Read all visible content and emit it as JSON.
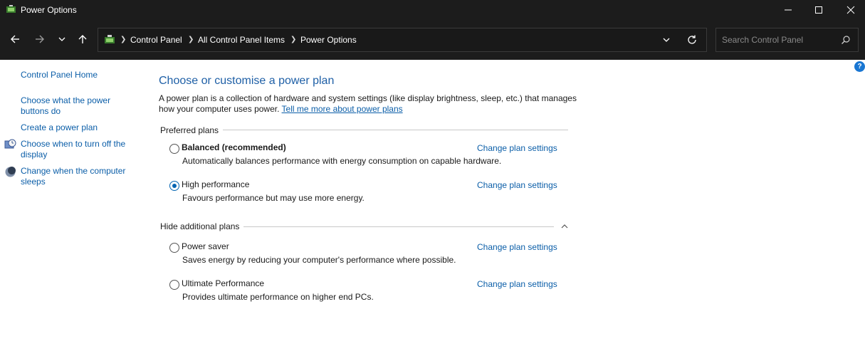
{
  "window": {
    "title": "Power Options",
    "icon": "power-options-icon",
    "controls": [
      "minimize-icon",
      "maximize-icon",
      "close-icon"
    ]
  },
  "nav": {
    "buttons": [
      "back-arrow-icon",
      "forward-arrow-icon",
      "recent-dropdown-icon",
      "up-arrow-icon"
    ],
    "breadcrumb": [
      "Control Panel",
      "All Control Panel Items",
      "Power Options"
    ],
    "search_placeholder": "Search Control Panel"
  },
  "sidebar": {
    "home": "Control Panel Home",
    "links": [
      "Choose what the power buttons do",
      "Create a power plan",
      "Choose when to turn off the display",
      "Change when the computer sleeps"
    ]
  },
  "main": {
    "heading": "Choose or customise a power plan",
    "description": "A power plan is a collection of hardware and system settings (like display brightness, sleep, etc.) that manages how your computer uses power.",
    "learn_more": "Tell me more about power plans",
    "preferred_label": "Preferred plans",
    "additional_label": "Hide additional plans",
    "change_link": "Change plan settings",
    "plans": [
      {
        "name": "Balanced (recommended)",
        "desc": "Automatically balances performance with energy consumption on capable hardware.",
        "selected": false
      },
      {
        "name": "High performance",
        "desc": "Favours performance but may use more energy.",
        "selected": true
      },
      {
        "name": "Power saver",
        "desc": "Saves energy by reducing your computer's performance where possible.",
        "selected": false
      },
      {
        "name": "Ultimate Performance",
        "desc": "Provides ultimate performance on higher end PCs.",
        "selected": false
      }
    ]
  },
  "colors": {
    "titlebar": "#1c1c1c",
    "link": "#0b5ea8",
    "heading": "#1e5fa6",
    "accent": "#0063b1"
  }
}
